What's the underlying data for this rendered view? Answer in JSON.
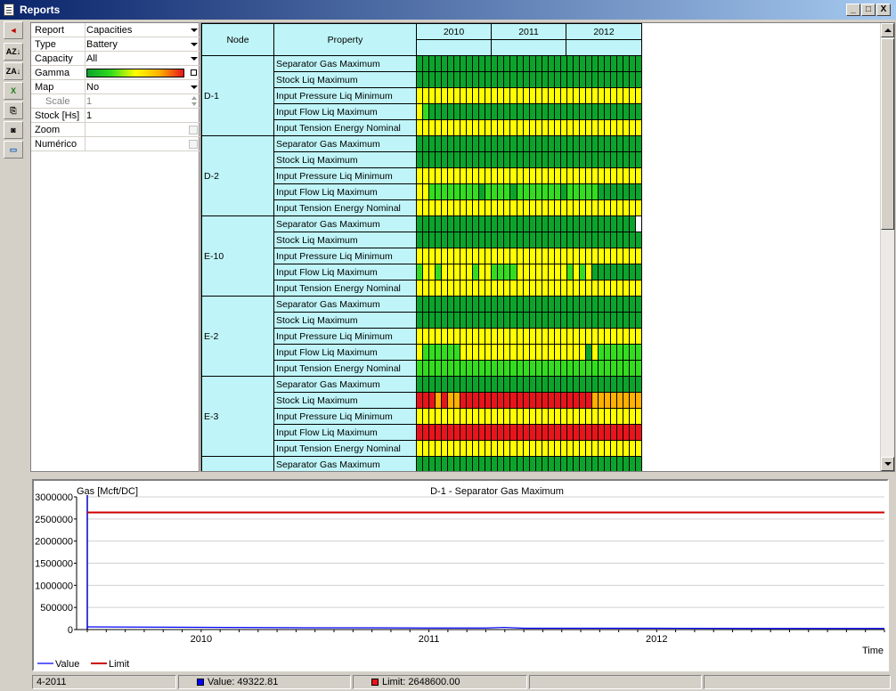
{
  "window": {
    "title": "Reports"
  },
  "window_buttons": {
    "minimize": "_",
    "maximize": "□",
    "close": "X"
  },
  "toolbar": [
    {
      "name": "back-arrow-icon",
      "glyph": "◄"
    },
    {
      "name": "sort-az-icon",
      "glyph": "AZ↓"
    },
    {
      "name": "sort-za-icon",
      "glyph": "ZA↓"
    },
    {
      "name": "export-excel-icon",
      "glyph": "X"
    },
    {
      "name": "copy-icon",
      "glyph": "⎘"
    },
    {
      "name": "camera-icon",
      "glyph": "◙"
    },
    {
      "name": "monitor-icon",
      "glyph": "▭"
    }
  ],
  "properties": [
    {
      "key": "Report",
      "value": "Capacities",
      "control": "dropdown"
    },
    {
      "key": "Type",
      "value": "Battery",
      "control": "dropdown"
    },
    {
      "key": "Capacity",
      "value": "All",
      "control": "dropdown"
    },
    {
      "key": "Gamma",
      "value": "",
      "control": "gamma"
    },
    {
      "key": "Map",
      "value": "No",
      "control": "dropdown"
    },
    {
      "key": "Scale",
      "value": "1",
      "control": "spinner",
      "disabled": true
    },
    {
      "key": "Stock [Hs]",
      "value": "1",
      "control": "text"
    },
    {
      "key": "Zoom",
      "value": "",
      "control": "checkbox"
    },
    {
      "key": "Numérico",
      "value": "",
      "control": "checkbox"
    }
  ],
  "grid": {
    "headers": {
      "node": "Node",
      "property": "Property",
      "years": [
        "2010",
        "2011",
        "2012"
      ]
    },
    "colors": {
      "G": "#0ca32c",
      "L": "#33dc1f",
      "Y": "#ffff00",
      "O": "#ffb000",
      "R": "#e8141b",
      "W": "#ffffff"
    },
    "nodes": [
      {
        "name": "D-1",
        "rows": [
          {
            "property": "Separator Gas Maximum",
            "cells": "GGGGGGGGGGGGGGGGGGGGGGGGGGGGGGGGGGGG"
          },
          {
            "property": "Stock Liq Maximum",
            "cells": "GGGGGGGGGGGGGGGGGGGGGGGGGGGGGGGGGGGG"
          },
          {
            "property": "Input Pressure Liq Minimum",
            "cells": "YYYYYYYYYYYYYYYYYYYYYYYYYYYYYYYYYYYY"
          },
          {
            "property": "Input Flow Liq Maximum",
            "cells": "YLGGGGGGGGGGGGGGGGGGGGGGGGGGGGGGGGGG"
          },
          {
            "property": "Input Tension Energy Nominal",
            "cells": "YYYYYYYYYYYYYYYYYYYYYYYYYYYYYYYYYYYY"
          }
        ]
      },
      {
        "name": "D-2",
        "rows": [
          {
            "property": "Separator Gas Maximum",
            "cells": "GGGGGGGGGGGGGGGGGGGGGGGGGGGGGGGGGGGG"
          },
          {
            "property": "Stock Liq Maximum",
            "cells": "GGGGGGGGGGGGGGGGGGGGGGGGGGGGGGGGGGGG"
          },
          {
            "property": "Input Pressure Liq Minimum",
            "cells": "YYYYYYYYYYYYYYYYYYYYYYYYYYYYYYYYYYYY"
          },
          {
            "property": "Input Flow Liq Maximum",
            "cells": "YYLLLLLLLLGLLLLGLLLLLLLGLLLLLGGGGGGG"
          },
          {
            "property": "Input Tension Energy Nominal",
            "cells": "YYYYYYYYYYYYYYYYYYYYYYYYYYYYYYYYYYYY"
          }
        ]
      },
      {
        "name": "E-10",
        "rows": [
          {
            "property": "Separator Gas Maximum",
            "cells": "GGGGGGGGGGGGGGGGGGGGGGGGGGGGGGGGGGGW"
          },
          {
            "property": "Stock Liq Maximum",
            "cells": "GGGGGGGGGGGGGGGGGGGGGGGGGGGGGGGGGGGG"
          },
          {
            "property": "Input Pressure Liq Minimum",
            "cells": "YYYYYYYYYYYYYYYYYYYYYYYYYYYYYYYYYYYY"
          },
          {
            "property": "Input Flow Liq Maximum",
            "cells": "LYYLYYYYYLYYLLLLYYYYYYYYLYLYGGGGGGGG"
          },
          {
            "property": "Input Tension Energy Nominal",
            "cells": "YYYYYYYYYYYYYYYYYYYYYYYYYYYYYYYYYYYY"
          }
        ]
      },
      {
        "name": "E-2",
        "rows": [
          {
            "property": "Separator Gas Maximum",
            "cells": "GGGGGGGGGGGGGGGGGGGGGGGGGGGGGGGGGGGG"
          },
          {
            "property": "Stock Liq Maximum",
            "cells": "GGGGGGGGGGGGGGGGGGGGGGGGGGGGGGGGGGGG"
          },
          {
            "property": "Input Pressure Liq Minimum",
            "cells": "YYYYYYYYYYYYYYYYYYYYYYYYYYYYYYYYYYYY"
          },
          {
            "property": "Input Flow Liq Maximum",
            "cells": "YLLLLLLYYYYYYYYYYYYYYYYYYYYGYLLLLLLL"
          },
          {
            "property": "Input Tension Energy Nominal",
            "cells": "LLLLLLLLLLLLLLLLLLLLLLLLLLLLLLLLLLLL"
          }
        ]
      },
      {
        "name": "E-3",
        "rows": [
          {
            "property": "Separator Gas Maximum",
            "cells": "GGGGGGGGGGGGGGGGGGGGGGGGGGGGGGGGGGGG"
          },
          {
            "property": "Stock Liq Maximum",
            "cells": "RRROROORRRRRRRRRRRRRRRRRRRRROOOOOOOO"
          },
          {
            "property": "Input Pressure Liq Minimum",
            "cells": "YYYYYYYYYYYYYYYYYYYYYYYYYYYYYYYYYYYY"
          },
          {
            "property": "Input Flow Liq Maximum",
            "cells": "RRRRRRRRRRRRRRRRRRRRRRRRRRRRRRRRRRRR"
          },
          {
            "property": "Input Tension Energy Nominal",
            "cells": "YYYYYYYYYYYYYYYYYYYYYYYYYYYYYYYYYYYY"
          }
        ]
      },
      {
        "name": "",
        "rows": [
          {
            "property": "Separator Gas Maximum",
            "cells": "GGGGGGGGGGGGGGGGGGGGGGGGGGGGGGGGGGGG"
          }
        ]
      }
    ]
  },
  "chart_data": {
    "type": "line",
    "title": "D-1 - Separator Gas Maximum",
    "ylabel": "Gas [Mcft/DC]",
    "xlabel": "Time",
    "ylim": [
      0,
      3000000
    ],
    "yticks": [
      "3000000",
      "2500000",
      "2000000",
      "1500000",
      "1000000",
      "500000",
      "0"
    ],
    "ytick_values": [
      3000000,
      2500000,
      2000000,
      1500000,
      1000000,
      500000,
      0
    ],
    "xlim": [
      2009.5,
      2013.0
    ],
    "xticks": [
      2010,
      2011,
      2012
    ],
    "xtick_labels": [
      "2010",
      "2011",
      "2012"
    ],
    "series": [
      {
        "name": "Value",
        "color": "#0000ff",
        "x": [
          2009.5,
          2009.75,
          2010.0,
          2010.25,
          2010.5,
          2010.75,
          2011.0,
          2011.25,
          2011.33,
          2011.42,
          2011.75,
          2012.0,
          2012.5,
          2013.0
        ],
        "y": [
          60000,
          55000,
          50000,
          45000,
          40000,
          40000,
          35000,
          35000,
          49322.81,
          30000,
          30000,
          30000,
          25000,
          25000
        ]
      },
      {
        "name": "Limit",
        "color": "#cc0000",
        "x": [
          2009.5,
          2013.0
        ],
        "y": [
          2648600,
          2648600
        ]
      }
    ],
    "legend": "bottom-left"
  },
  "status": {
    "period": "4-2011",
    "value_text": "Value: 49322.81",
    "limit_text": "Limit: 2648600.00",
    "value_color": "#0000ff",
    "limit_color": "#e8141b"
  }
}
